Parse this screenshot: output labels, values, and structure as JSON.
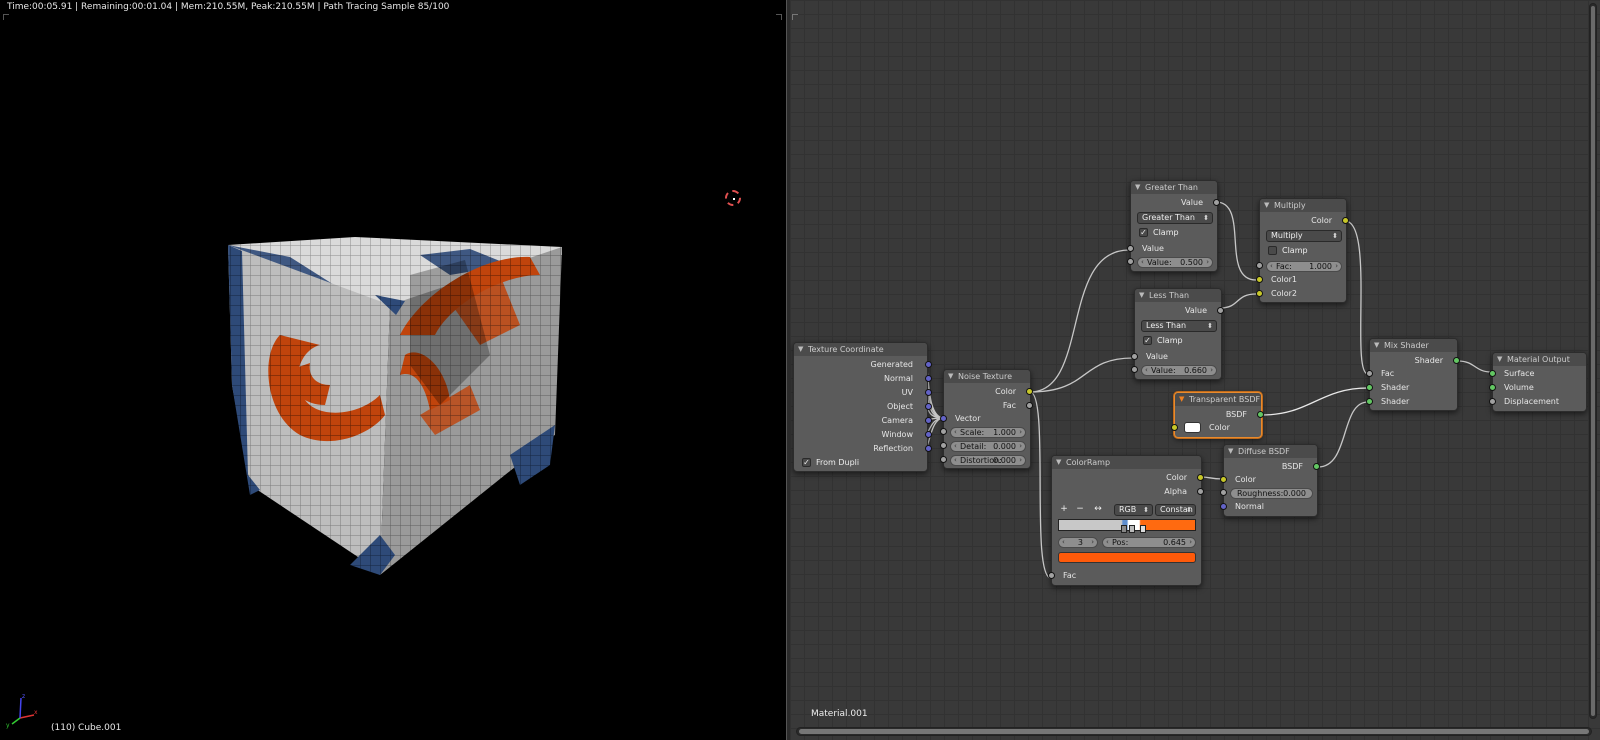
{
  "viewport": {
    "render_status": "Time:00:05.91 | Remaining:00:01.04 | Mem:210.55M, Peak:210.55M | Path Tracing Sample 85/100",
    "object_info": "(110) Cube.001",
    "axes": {
      "x": "x",
      "y": "y",
      "z": "z"
    }
  },
  "node_editor": {
    "material_name": "Material.001",
    "nodes": {
      "texture_coordinate": {
        "title": "Texture Coordinate",
        "outputs": [
          "Generated",
          "Normal",
          "UV",
          "Object",
          "Camera",
          "Window",
          "Reflection"
        ],
        "from_dupli_label": "From Dupli",
        "from_dupli_checked": true
      },
      "noise_texture": {
        "title": "Noise Texture",
        "outputs": [
          "Color",
          "Fac"
        ],
        "vector_label": "Vector",
        "fields": [
          {
            "label": "Scale:",
            "value": "1.000"
          },
          {
            "label": "Detail:",
            "value": "0.000"
          },
          {
            "label": "Distortion:",
            "value": "0.000"
          }
        ]
      },
      "greater_than": {
        "title": "Greater Than",
        "output": "Value",
        "operation": "Greater Than",
        "clamp_label": "Clamp",
        "clamp_checked": true,
        "input_label": "Value",
        "field": {
          "label": "Value:",
          "value": "0.500"
        }
      },
      "less_than": {
        "title": "Less Than",
        "output": "Value",
        "operation": "Less Than",
        "clamp_label": "Clamp",
        "clamp_checked": true,
        "input_label": "Value",
        "field": {
          "label": "Value:",
          "value": "0.660"
        }
      },
      "multiply": {
        "title": "Multiply",
        "output": "Color",
        "operation": "Multiply",
        "clamp_label": "Clamp",
        "clamp_checked": false,
        "fac": {
          "label": "Fac:",
          "value": "1.000"
        },
        "inputs": [
          "Color1",
          "Color2"
        ]
      },
      "transparent_bsdf": {
        "title": "Transparent BSDF",
        "output": "BSDF",
        "color_label": "Color",
        "swatch": "#ffffff"
      },
      "color_ramp": {
        "title": "ColorRamp",
        "outputs": [
          "Color",
          "Alpha"
        ],
        "add_button": "+",
        "remove_button": "−",
        "flip_button": "↔",
        "color_mode": "RGB",
        "interpolation": "Constan",
        "stop_index": "3",
        "pos": {
          "label": "Pos:",
          "value": "0.645"
        },
        "ramp_left": "#c8c8c8",
        "ramp_right": "#ff6a10",
        "active_color": "#ff5a0a",
        "input_label": "Fac"
      },
      "diffuse_bsdf": {
        "title": "Diffuse BSDF",
        "output": "BSDF",
        "color_label": "Color",
        "roughness": {
          "label": "Roughness:",
          "value": "0.000"
        },
        "normal_label": "Normal"
      },
      "mix_shader": {
        "title": "Mix Shader",
        "output": "Shader",
        "inputs": [
          "Fac",
          "Shader",
          "Shader"
        ]
      },
      "material_output": {
        "title": "Material Output",
        "inputs": [
          "Surface",
          "Volume",
          "Displacement"
        ]
      }
    }
  },
  "colors": {
    "socket_vector": "#6363c7",
    "socket_color": "#c7c729",
    "socket_value": "#a1a1a1",
    "socket_shader": "#63c763",
    "selected_outline": "#e88b2e",
    "cube_orange": "#c0440c",
    "cube_blue": "#2e4a78",
    "cube_white": "#cfcfcf"
  }
}
